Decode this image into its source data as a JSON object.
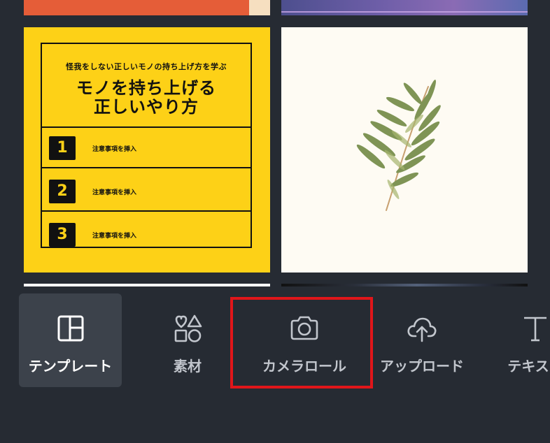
{
  "templates": {
    "yellow_card": {
      "subtitle": "怪我をしない正しいモノの持ち上げ方を学ぶ",
      "title_line1": "モノを持ち上げる",
      "title_line2": "正しいやり方",
      "rows": [
        {
          "number": "1",
          "text": "注意事項を挿入"
        },
        {
          "number": "2",
          "text": "注意事項を挿入"
        },
        {
          "number": "3",
          "text": "注意事項を挿入"
        }
      ]
    }
  },
  "toolbar": {
    "templates_label": "テンプレート",
    "elements_label": "素材",
    "camera_label": "カメラロール",
    "upload_label": "アップロード",
    "text_label": "テキスト"
  },
  "colors": {
    "background": "#262b33",
    "active_tab_bg": "#3c424b",
    "yellow": "#fdd117",
    "highlight": "#e0161a"
  }
}
